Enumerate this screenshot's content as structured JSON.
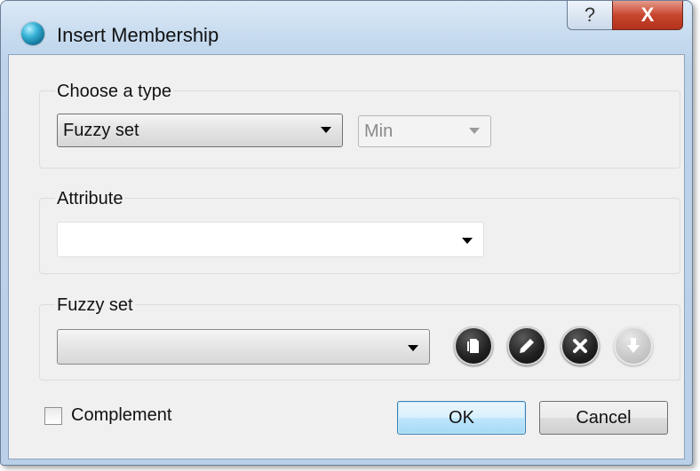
{
  "window": {
    "title": "Insert Membership"
  },
  "titlebar": {
    "help_label": "?",
    "close_label": "X"
  },
  "type_group": {
    "title": "Choose a type",
    "type_value": "Fuzzy set",
    "operator_value": "Min"
  },
  "attribute_group": {
    "title": "Attribute",
    "value": ""
  },
  "fuzzy_group": {
    "title": "Fuzzy set",
    "value": "",
    "buttons": [
      "new-icon",
      "edit-icon",
      "delete-icon",
      "download-icon"
    ]
  },
  "footer": {
    "complement_label": "Complement",
    "complement_checked": false,
    "ok_label": "OK",
    "cancel_label": "Cancel"
  }
}
